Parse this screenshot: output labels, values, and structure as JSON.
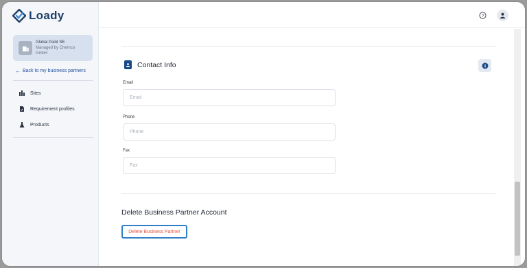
{
  "app": {
    "brand": "Loady"
  },
  "sidebar": {
    "partner": {
      "name": "Global Paint SE",
      "managed_by": "Managed by Chemco GmbH"
    },
    "back_link": "Back to my business partners",
    "items": [
      {
        "label": "Sites",
        "icon": "sites-icon"
      },
      {
        "label": "Requirement profiles",
        "icon": "requirement-profile-icon"
      },
      {
        "label": "Products",
        "icon": "products-icon"
      }
    ]
  },
  "header": {
    "help_icon": "help-icon",
    "user_icon": "user-icon"
  },
  "contact_info": {
    "title": "Contact Info",
    "fields": [
      {
        "label": "Email",
        "placeholder": "Email",
        "value": ""
      },
      {
        "label": "Phone",
        "placeholder": "Phone",
        "value": ""
      },
      {
        "label": "Fax",
        "placeholder": "Fax",
        "value": ""
      }
    ]
  },
  "delete_section": {
    "title": "Delete Business Partner Account",
    "button_label": "Delete Business Partner"
  },
  "colors": {
    "brand": "#1f3f66",
    "accent": "#1a4a86",
    "danger": "#e0523f",
    "focus": "#2f7fc8"
  }
}
